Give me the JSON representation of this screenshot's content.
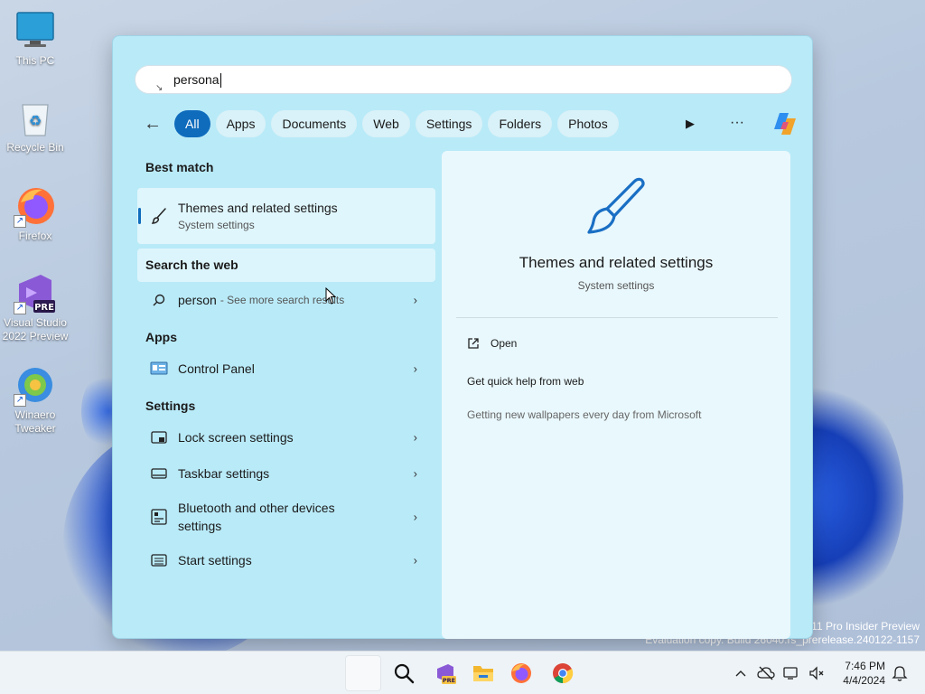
{
  "desktop": {
    "icons": [
      {
        "label": "This PC"
      },
      {
        "label": "Recycle Bin"
      },
      {
        "label": "Firefox"
      },
      {
        "label": "Visual Studio 2022 Preview",
        "badge": "PRE"
      },
      {
        "label": "Winaero Tweaker"
      }
    ],
    "watermark": {
      "line1": "11 Pro Insider Preview",
      "line2": "Evaluation copy. Build 26040.rs_prerelease.240122-1157"
    }
  },
  "search": {
    "query": "persona",
    "filters": [
      "All",
      "Apps",
      "Documents",
      "Web",
      "Settings",
      "Folders",
      "Photos"
    ],
    "active_filter": "All",
    "more_label": "···"
  },
  "results": {
    "best_match_heading": "Best match",
    "best_match": {
      "title": "Themes and related settings",
      "subtitle": "System settings"
    },
    "web_heading": "Search the web",
    "web_result": {
      "term": "person",
      "hint": "- See more search results"
    },
    "apps_heading": "Apps",
    "apps": [
      {
        "label": "Control Panel"
      }
    ],
    "settings_heading": "Settings",
    "settings": [
      {
        "label": "Lock screen settings"
      },
      {
        "label": "Taskbar settings"
      },
      {
        "label": "Bluetooth and other devices settings"
      },
      {
        "label": "Start settings"
      }
    ]
  },
  "preview": {
    "title": "Themes and related settings",
    "subtitle": "System settings",
    "open_label": "Open",
    "quick_help_label": "Get quick help from web",
    "tip_label": "Getting new wallpapers every day from Microsoft"
  },
  "taskbar": {
    "vs_badge": "PRE",
    "time": "7:46 PM",
    "date": "4/4/2024"
  },
  "colors": {
    "accent": "#0f6cbd",
    "panel": "#b9eaf8",
    "preview": "#e9f8fd"
  }
}
